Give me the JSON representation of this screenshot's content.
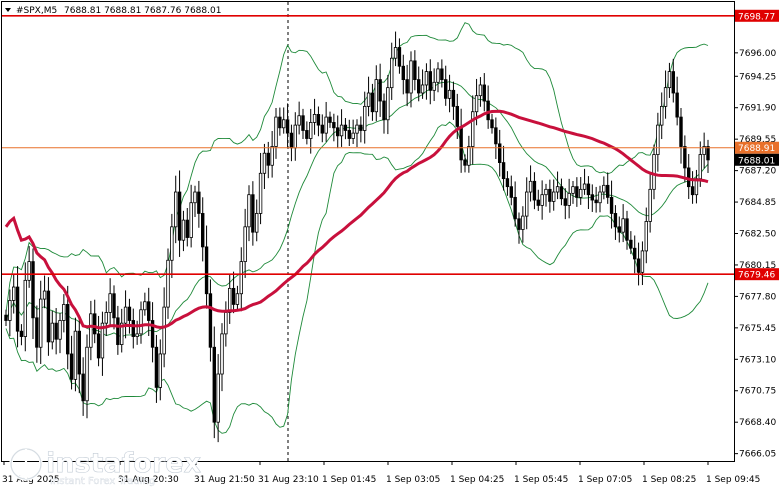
{
  "header": {
    "symbol": "#SPX,M5",
    "ohlc": "7688.81 7688.81 7687.76 7688.01"
  },
  "branding": {
    "logo_name": "instaforex",
    "tagline": "Instant Forex Trading"
  },
  "colors": {
    "candle": "#000000",
    "bollinger": "#1f8a3a",
    "moving_average": "#c8103c",
    "level_line": "#e00000",
    "price_line": "#e8702a",
    "grid_dashed": "#000000"
  },
  "chart_data": {
    "type": "candlestick",
    "symbol": "#SPX",
    "timeframe": "M5",
    "ylim": [
      7665.5,
      7699.8
    ],
    "y_ticks": [
      "7696.00",
      "7694.25",
      "7691.90",
      "7689.55",
      "7687.20",
      "7684.85",
      "7682.50",
      "7680.15",
      "7677.80",
      "7675.45",
      "7673.10",
      "7670.75",
      "7668.40",
      "7666.05"
    ],
    "x_ticks": [
      "31 Aug 2025",
      "31 Aug 20:30",
      "31 Aug 21:50",
      "31 Aug 23:10",
      "1 Sep 01:45",
      "1 Sep 03:05",
      "1 Sep 04:25",
      "1 Sep 05:45",
      "1 Sep 07:05",
      "1 Sep 08:25",
      "1 Sep 09:45"
    ],
    "horizontal_levels": [
      {
        "value": 7698.77,
        "label": "7698.77",
        "style": "level"
      },
      {
        "value": 7688.91,
        "label": "7688.91",
        "style": "price"
      },
      {
        "value": 7688.01,
        "label": "7688.01",
        "style": "current"
      },
      {
        "value": 7679.46,
        "label": "7679.46",
        "style": "level"
      }
    ],
    "closes": [
      7676.0,
      7677.5,
      7678.5,
      7675.2,
      7674.8,
      7679.0,
      7680.4,
      7676.2,
      7674.0,
      7677.6,
      7678.2,
      7674.4,
      7675.8,
      7674.6,
      7676.0,
      7677.2,
      7673.5,
      7671.6,
      7675.2,
      7672.0,
      7670.0,
      7674.0,
      7676.5,
      7675.0,
      7673.2,
      7675.8,
      7676.6,
      7678.0,
      7676.2,
      7674.2,
      7675.8,
      7677.0,
      7676.0,
      7674.8,
      7675.0,
      7676.8,
      7677.4,
      7676.0,
      7674.0,
      7671.0,
      7673.5,
      7677.0,
      7680.5,
      7683.0,
      7685.6,
      7682.0,
      7683.5,
      7682.2,
      7684.8,
      7685.6,
      7684.0,
      7681.5,
      7678.0,
      7674.0,
      7668.4,
      7672.0,
      7675.0,
      7676.6,
      7678.4,
      7677.2,
      7678.0,
      7680.4,
      7683.0,
      7685.4,
      7682.6,
      7684.0,
      7687.0,
      7688.5,
      7687.6,
      7689.0,
      7691.2,
      7690.4,
      7691.0,
      7690.0,
      7688.9,
      7690.6,
      7691.3,
      7690.2,
      7689.6,
      7690.8,
      7691.4,
      7690.6,
      7690.0,
      7691.2,
      7690.8,
      7690.4,
      7689.8,
      7690.6,
      7690.2,
      7689.6,
      7690.0,
      7690.6,
      7690.2,
      7692.0,
      7693.0,
      7691.6,
      7694.0,
      7692.4,
      7691.0,
      7693.4,
      7695.6,
      7696.4,
      7695.0,
      7694.0,
      7693.0,
      7695.4,
      7694.0,
      7693.0,
      7693.6,
      7694.6,
      7693.2,
      7693.8,
      7694.8,
      7694.0,
      7692.6,
      7693.2,
      7692.0,
      7690.5,
      7688.0,
      7687.6,
      7689.0,
      7691.6,
      7692.8,
      7693.6,
      7692.4,
      7691.0,
      7690.4,
      7689.2,
      7687.8,
      7686.6,
      7686.0,
      7685.2,
      7683.6,
      7682.8,
      7683.8,
      7685.6,
      7686.4,
      7685.0,
      7684.6,
      7685.4,
      7685.8,
      7684.9,
      7685.6,
      7686.0,
      7685.1,
      7684.6,
      7685.5,
      7686.0,
      7685.2,
      7685.8,
      7686.2,
      7685.4,
      7685.0,
      7684.8,
      7685.6,
      7686.1,
      7685.2,
      7684.0,
      7683.0,
      7682.6,
      7683.6,
      7682.0,
      7681.4,
      7680.6,
      7679.6,
      7681.2,
      7683.4,
      7685.8,
      7688.4,
      7690.6,
      7692.0,
      7693.4,
      7694.6,
      7693.0,
      7691.2,
      7689.0,
      7687.4,
      7686.0,
      7685.4,
      7686.6,
      7688.4,
      7689.0,
      7688.0
    ]
  }
}
